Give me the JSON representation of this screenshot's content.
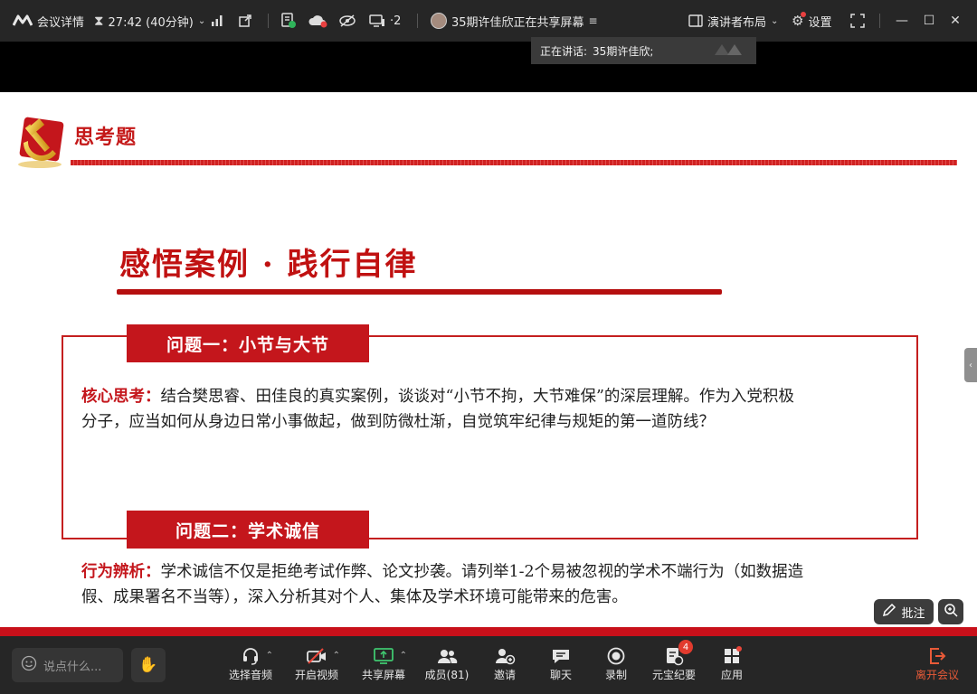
{
  "topbar": {
    "meeting_details": "会议详情",
    "timer": "27:42 (40分钟)",
    "participant_count": "·2",
    "sharing_status": "35期许佳欣正在共享屏幕",
    "layout_label": "演讲者布局",
    "settings_label": "设置"
  },
  "speaking_tooltip": {
    "label": "正在讲话:",
    "name": "35期许佳欣;"
  },
  "slide": {
    "header_title": "思考题",
    "main_title": "感悟案例 · 践行自律",
    "question1": {
      "tag": "问题一：小节与大节",
      "label": "核心思考：",
      "line1": "结合樊思睿、田佳良的真实案例，谈谈对“小节不拘，大节难保”的深层理解。作为入党积极",
      "line2": "分子，应当如何从身边日常小事做起，做到防微杜渐，自觉筑牢纪律与规矩的第一道防线？"
    },
    "question2": {
      "tag": "问题二：学术诚信",
      "label": "行为辨析：",
      "line1": "学术诚信不仅是拒绝考试作弊、论文抄袭。请列举1-2个易被忽视的学术不端行为（如数据造",
      "line2": "假、成果署名不当等），深入分析其对个人、集体及学术环境可能带来的危害。"
    }
  },
  "annotate_label": "批注",
  "toolbar": {
    "chat_placeholder": "说点什么...",
    "audio": "选择音频",
    "video": "开启视频",
    "share": "共享屏幕",
    "members": "成员(81)",
    "invite": "邀请",
    "chat": "聊天",
    "record": "录制",
    "yuanbao": "元宝纪要",
    "yuanbao_badge": "4",
    "apps": "应用",
    "leave": "离开会议"
  },
  "colors": {
    "accent_red": "#c4161c",
    "leave_orange": "#e85a38",
    "toolbar_bg": "#262626"
  }
}
